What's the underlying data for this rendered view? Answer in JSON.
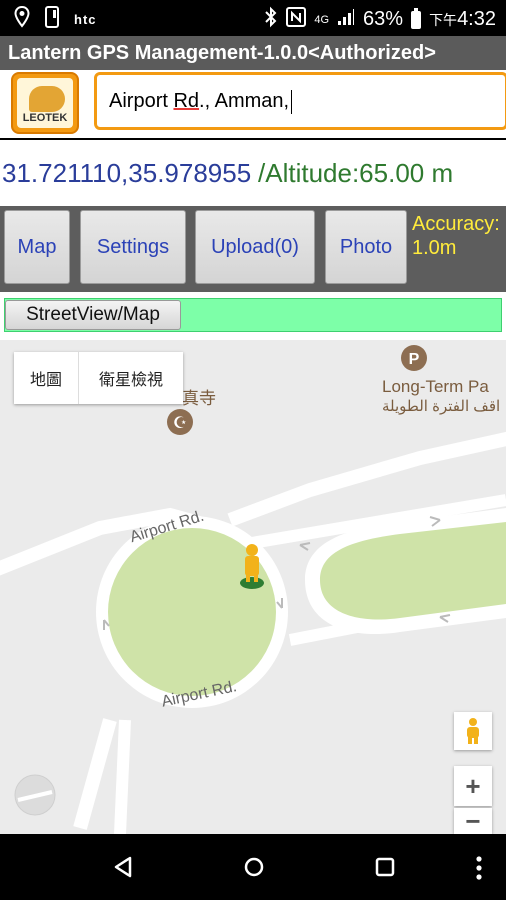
{
  "status_bar": {
    "carrier": "htc",
    "network": "4G",
    "battery": "63%",
    "time_prefix": "下午",
    "time": "4:32"
  },
  "app": {
    "title": "Lantern GPS Management-1.0.0<Authorized>",
    "logo_text": "LEOTEK"
  },
  "search": {
    "value_part1": "Airport ",
    "value_part2": "Rd",
    "value_part3": "., Amman,"
  },
  "position": {
    "latlon": "31.721110,35.978955",
    "altitude": "/Altitude:65.00 m"
  },
  "buttons": {
    "map": "Map",
    "settings": "Settings",
    "upload": "Upload(0)",
    "photo": "Photo"
  },
  "accuracy": {
    "label": "Accuracy:",
    "value": "1.0m"
  },
  "streetview_button": "StreetView/Map",
  "map": {
    "type_map": "地圖",
    "type_satellite": "衛星檢視",
    "poi_mosque": "真寺",
    "poi_parking_en": "Long-Term Pa",
    "poi_parking_ar": "اقف الفترة الطويلة",
    "road_label_top": "Airport Rd.",
    "road_label_bottom": "Airport Rd.",
    "zoom_in": "+",
    "zoom_out": "−",
    "colors": {
      "park": "#cfe3a8",
      "road": "#ffffff",
      "background": "#ebebeb"
    }
  }
}
